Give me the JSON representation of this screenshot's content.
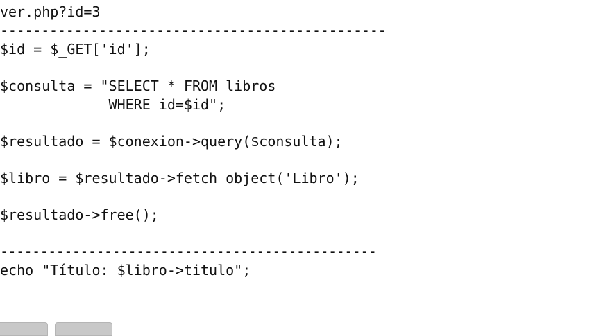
{
  "code_lines": [
    "ver.php?id=3",
    "-----------------------------------------------",
    "$id = $_GET['id'];",
    "$consulta = \"SELECT * FROM libros",
    "             WHERE id=$id\";",
    "$resultado = $conexion->query($consulta);",
    "$libro = $resultado->fetch_object('Libro');",
    "$resultado->free();",
    "-----------------------------------------------",
    "echo \"Título: $libro->titulo\";"
  ],
  "buttons": [
    "",
    ""
  ]
}
